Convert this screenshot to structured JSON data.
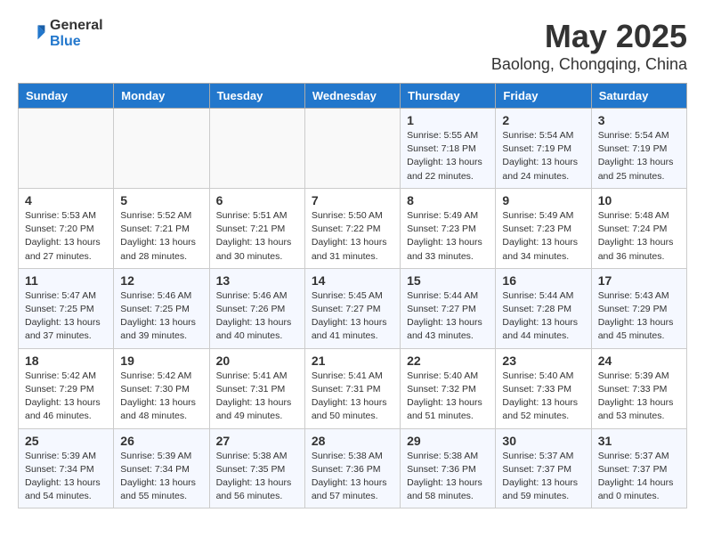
{
  "header": {
    "logo_general": "General",
    "logo_blue": "Blue",
    "month": "May 2025",
    "location": "Baolong, Chongqing, China"
  },
  "days_of_week": [
    "Sunday",
    "Monday",
    "Tuesday",
    "Wednesday",
    "Thursday",
    "Friday",
    "Saturday"
  ],
  "weeks": [
    [
      {
        "day": "",
        "info": ""
      },
      {
        "day": "",
        "info": ""
      },
      {
        "day": "",
        "info": ""
      },
      {
        "day": "",
        "info": ""
      },
      {
        "day": "1",
        "info": "Sunrise: 5:55 AM\nSunset: 7:18 PM\nDaylight: 13 hours\nand 22 minutes."
      },
      {
        "day": "2",
        "info": "Sunrise: 5:54 AM\nSunset: 7:19 PM\nDaylight: 13 hours\nand 24 minutes."
      },
      {
        "day": "3",
        "info": "Sunrise: 5:54 AM\nSunset: 7:19 PM\nDaylight: 13 hours\nand 25 minutes."
      }
    ],
    [
      {
        "day": "4",
        "info": "Sunrise: 5:53 AM\nSunset: 7:20 PM\nDaylight: 13 hours\nand 27 minutes."
      },
      {
        "day": "5",
        "info": "Sunrise: 5:52 AM\nSunset: 7:21 PM\nDaylight: 13 hours\nand 28 minutes."
      },
      {
        "day": "6",
        "info": "Sunrise: 5:51 AM\nSunset: 7:21 PM\nDaylight: 13 hours\nand 30 minutes."
      },
      {
        "day": "7",
        "info": "Sunrise: 5:50 AM\nSunset: 7:22 PM\nDaylight: 13 hours\nand 31 minutes."
      },
      {
        "day": "8",
        "info": "Sunrise: 5:49 AM\nSunset: 7:23 PM\nDaylight: 13 hours\nand 33 minutes."
      },
      {
        "day": "9",
        "info": "Sunrise: 5:49 AM\nSunset: 7:23 PM\nDaylight: 13 hours\nand 34 minutes."
      },
      {
        "day": "10",
        "info": "Sunrise: 5:48 AM\nSunset: 7:24 PM\nDaylight: 13 hours\nand 36 minutes."
      }
    ],
    [
      {
        "day": "11",
        "info": "Sunrise: 5:47 AM\nSunset: 7:25 PM\nDaylight: 13 hours\nand 37 minutes."
      },
      {
        "day": "12",
        "info": "Sunrise: 5:46 AM\nSunset: 7:25 PM\nDaylight: 13 hours\nand 39 minutes."
      },
      {
        "day": "13",
        "info": "Sunrise: 5:46 AM\nSunset: 7:26 PM\nDaylight: 13 hours\nand 40 minutes."
      },
      {
        "day": "14",
        "info": "Sunrise: 5:45 AM\nSunset: 7:27 PM\nDaylight: 13 hours\nand 41 minutes."
      },
      {
        "day": "15",
        "info": "Sunrise: 5:44 AM\nSunset: 7:27 PM\nDaylight: 13 hours\nand 43 minutes."
      },
      {
        "day": "16",
        "info": "Sunrise: 5:44 AM\nSunset: 7:28 PM\nDaylight: 13 hours\nand 44 minutes."
      },
      {
        "day": "17",
        "info": "Sunrise: 5:43 AM\nSunset: 7:29 PM\nDaylight: 13 hours\nand 45 minutes."
      }
    ],
    [
      {
        "day": "18",
        "info": "Sunrise: 5:42 AM\nSunset: 7:29 PM\nDaylight: 13 hours\nand 46 minutes."
      },
      {
        "day": "19",
        "info": "Sunrise: 5:42 AM\nSunset: 7:30 PM\nDaylight: 13 hours\nand 48 minutes."
      },
      {
        "day": "20",
        "info": "Sunrise: 5:41 AM\nSunset: 7:31 PM\nDaylight: 13 hours\nand 49 minutes."
      },
      {
        "day": "21",
        "info": "Sunrise: 5:41 AM\nSunset: 7:31 PM\nDaylight: 13 hours\nand 50 minutes."
      },
      {
        "day": "22",
        "info": "Sunrise: 5:40 AM\nSunset: 7:32 PM\nDaylight: 13 hours\nand 51 minutes."
      },
      {
        "day": "23",
        "info": "Sunrise: 5:40 AM\nSunset: 7:33 PM\nDaylight: 13 hours\nand 52 minutes."
      },
      {
        "day": "24",
        "info": "Sunrise: 5:39 AM\nSunset: 7:33 PM\nDaylight: 13 hours\nand 53 minutes."
      }
    ],
    [
      {
        "day": "25",
        "info": "Sunrise: 5:39 AM\nSunset: 7:34 PM\nDaylight: 13 hours\nand 54 minutes."
      },
      {
        "day": "26",
        "info": "Sunrise: 5:39 AM\nSunset: 7:34 PM\nDaylight: 13 hours\nand 55 minutes."
      },
      {
        "day": "27",
        "info": "Sunrise: 5:38 AM\nSunset: 7:35 PM\nDaylight: 13 hours\nand 56 minutes."
      },
      {
        "day": "28",
        "info": "Sunrise: 5:38 AM\nSunset: 7:36 PM\nDaylight: 13 hours\nand 57 minutes."
      },
      {
        "day": "29",
        "info": "Sunrise: 5:38 AM\nSunset: 7:36 PM\nDaylight: 13 hours\nand 58 minutes."
      },
      {
        "day": "30",
        "info": "Sunrise: 5:37 AM\nSunset: 7:37 PM\nDaylight: 13 hours\nand 59 minutes."
      },
      {
        "day": "31",
        "info": "Sunrise: 5:37 AM\nSunset: 7:37 PM\nDaylight: 14 hours\nand 0 minutes."
      }
    ]
  ]
}
